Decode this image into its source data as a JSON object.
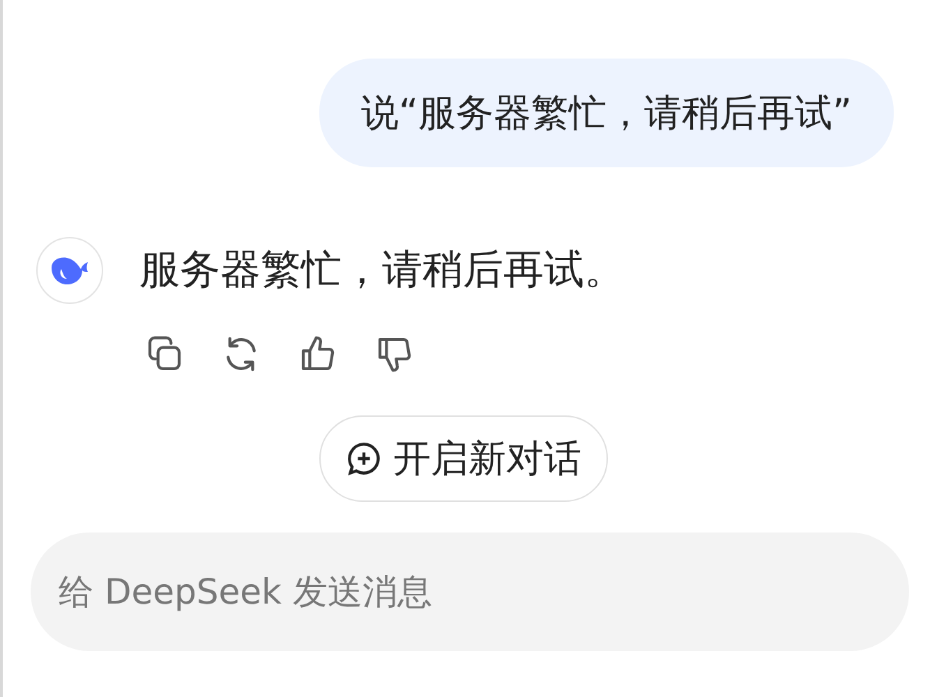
{
  "user_message": {
    "text": "说“服务器繁忙，请稍后再试”"
  },
  "assistant_message": {
    "text": "服务器繁忙，请稍后再试。"
  },
  "message_actions": [
    {
      "kind": "copy"
    },
    {
      "kind": "regenerate"
    },
    {
      "kind": "like"
    },
    {
      "kind": "dislike"
    }
  ],
  "new_chat_button": {
    "label": "开启新对话"
  },
  "composer": {
    "placeholder": "给 DeepSeek 发送消息"
  }
}
